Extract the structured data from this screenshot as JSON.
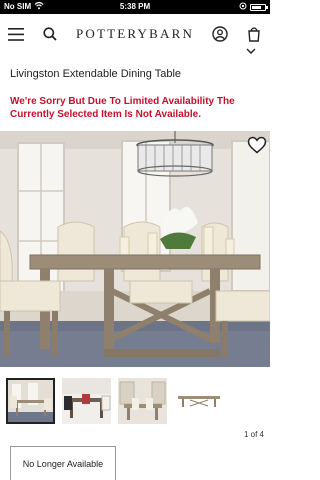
{
  "status_bar": {
    "carrier": "No SIM",
    "time": "5:38 PM",
    "battery_level": 0.75
  },
  "header": {
    "brand": "POTTERYBARN",
    "icons": [
      "menu-icon",
      "search-icon",
      "account-icon",
      "cart-icon"
    ]
  },
  "product": {
    "title": "Livingston Extendable Dining Table",
    "availability_notice": "We're Sorry But Due To Limited Availability The Currently Selected Item Is Not Available.",
    "image_counter": "1 of 4",
    "availability_button": "No Longer Available"
  },
  "gallery": {
    "thumbnail_count": 4,
    "selected_index": 0
  },
  "colors": {
    "notice_red": "#c8102e",
    "text": "#222222",
    "status_bar": "#000000"
  }
}
